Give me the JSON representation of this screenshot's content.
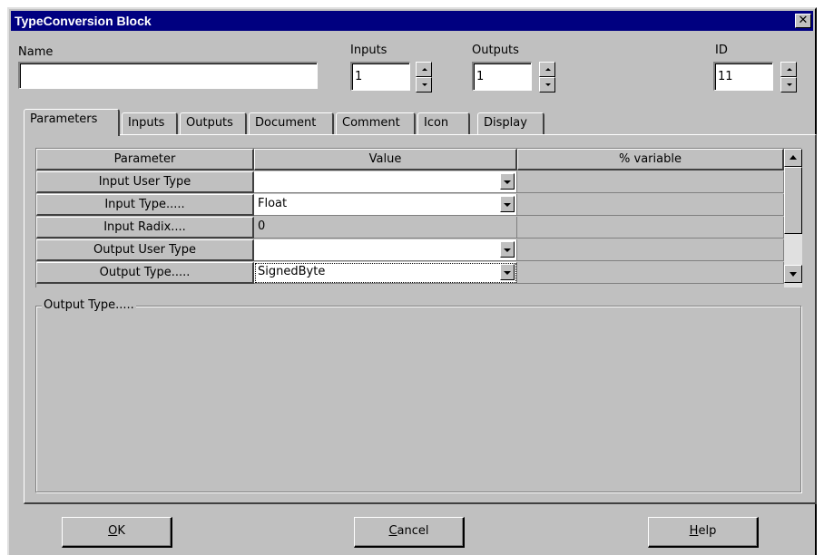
{
  "window": {
    "title": "TypeConversion Block",
    "close_glyph": "✕"
  },
  "fields": {
    "name": {
      "label": "Name",
      "value": ""
    },
    "inputs": {
      "label": "Inputs",
      "value": "1"
    },
    "outputs": {
      "label": "Outputs",
      "value": "1"
    },
    "id": {
      "label": "ID",
      "value": "11"
    }
  },
  "tabs": [
    {
      "label": "Parameters",
      "active": true
    },
    {
      "label": "Inputs"
    },
    {
      "label": "Outputs"
    },
    {
      "label": "Document"
    },
    {
      "label": "Comment"
    },
    {
      "label": "Icon"
    },
    {
      "label": "Display"
    }
  ],
  "grid": {
    "headers": {
      "parameter": "Parameter",
      "value": "Value",
      "variable": "% variable"
    },
    "rows": [
      {
        "parameter": "Input  User Type",
        "value": ""
      },
      {
        "parameter": "Input  Type.....",
        "value": "Float"
      },
      {
        "parameter": "Input  Radix....",
        "value": "0"
      },
      {
        "parameter": "Output User Type",
        "value": ""
      },
      {
        "parameter": "Output Type.....",
        "value": "SignedByte"
      }
    ]
  },
  "description": {
    "title": "Output Type.....",
    "text": ""
  },
  "buttons": {
    "ok": {
      "mnemonic": "O",
      "rest": "K"
    },
    "cancel": {
      "mnemonic": "C",
      "rest": "ancel"
    },
    "help": {
      "mnemonic": "H",
      "rest": "elp"
    }
  },
  "colors": {
    "title_bar": "#000080",
    "face": "#c0c0c0"
  }
}
